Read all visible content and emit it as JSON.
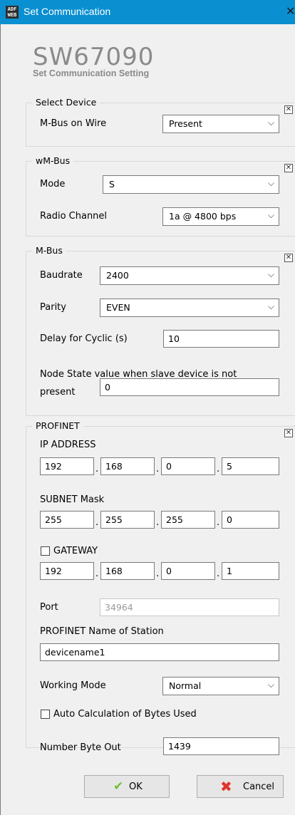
{
  "window": {
    "title": "Set Communication",
    "app_icon_text": "ADF WEB"
  },
  "brand": {
    "title": "SW67090",
    "subtitle": "Set Communication Setting"
  },
  "select_device": {
    "legend": "Select Device",
    "mbus_on_wire": {
      "label": "M-Bus on Wire",
      "value": "Present"
    }
  },
  "wmbus": {
    "legend": "wM-Bus",
    "mode": {
      "label": "Mode",
      "value": "S"
    },
    "radio_channel": {
      "label": "Radio Channel",
      "value": "1a @ 4800 bps"
    }
  },
  "mbus": {
    "legend": "M-Bus",
    "baudrate": {
      "label": "Baudrate",
      "value": "2400"
    },
    "parity": {
      "label": "Parity",
      "value": "EVEN"
    },
    "delay_cyclic": {
      "label": "Delay for Cyclic (s)",
      "value": "10"
    },
    "node_state": {
      "label_line1": "Node State value when slave device is not",
      "label_line2": "present",
      "value": "0"
    }
  },
  "profinet": {
    "legend": "PROFINET",
    "ip_address": {
      "label": "IP ADDRESS",
      "octets": [
        "192",
        "168",
        "0",
        "5"
      ]
    },
    "subnet_mask": {
      "label": "SUBNET Mask",
      "octets": [
        "255",
        "255",
        "255",
        "0"
      ]
    },
    "gateway": {
      "label": "GATEWAY",
      "checked": false,
      "octets": [
        "192",
        "168",
        "0",
        "1"
      ]
    },
    "port": {
      "label": "Port",
      "value": "34964"
    },
    "station_name": {
      "label": "PROFINET Name of Station",
      "value": "devicename1"
    },
    "working_mode": {
      "label": "Working Mode",
      "value": "Normal"
    },
    "auto_calc": {
      "label": "Auto Calculation of Bytes Used",
      "checked": false
    },
    "number_byte_out": {
      "label": "Number Byte Out",
      "value": "1439"
    }
  },
  "buttons": {
    "ok": "OK",
    "cancel": "Cancel"
  },
  "colors": {
    "titlebar": "#0a8fd1",
    "panel_bg": "#f0f0f0",
    "ok_check": "#6fbf3a",
    "cancel_x": "#e0342b"
  }
}
